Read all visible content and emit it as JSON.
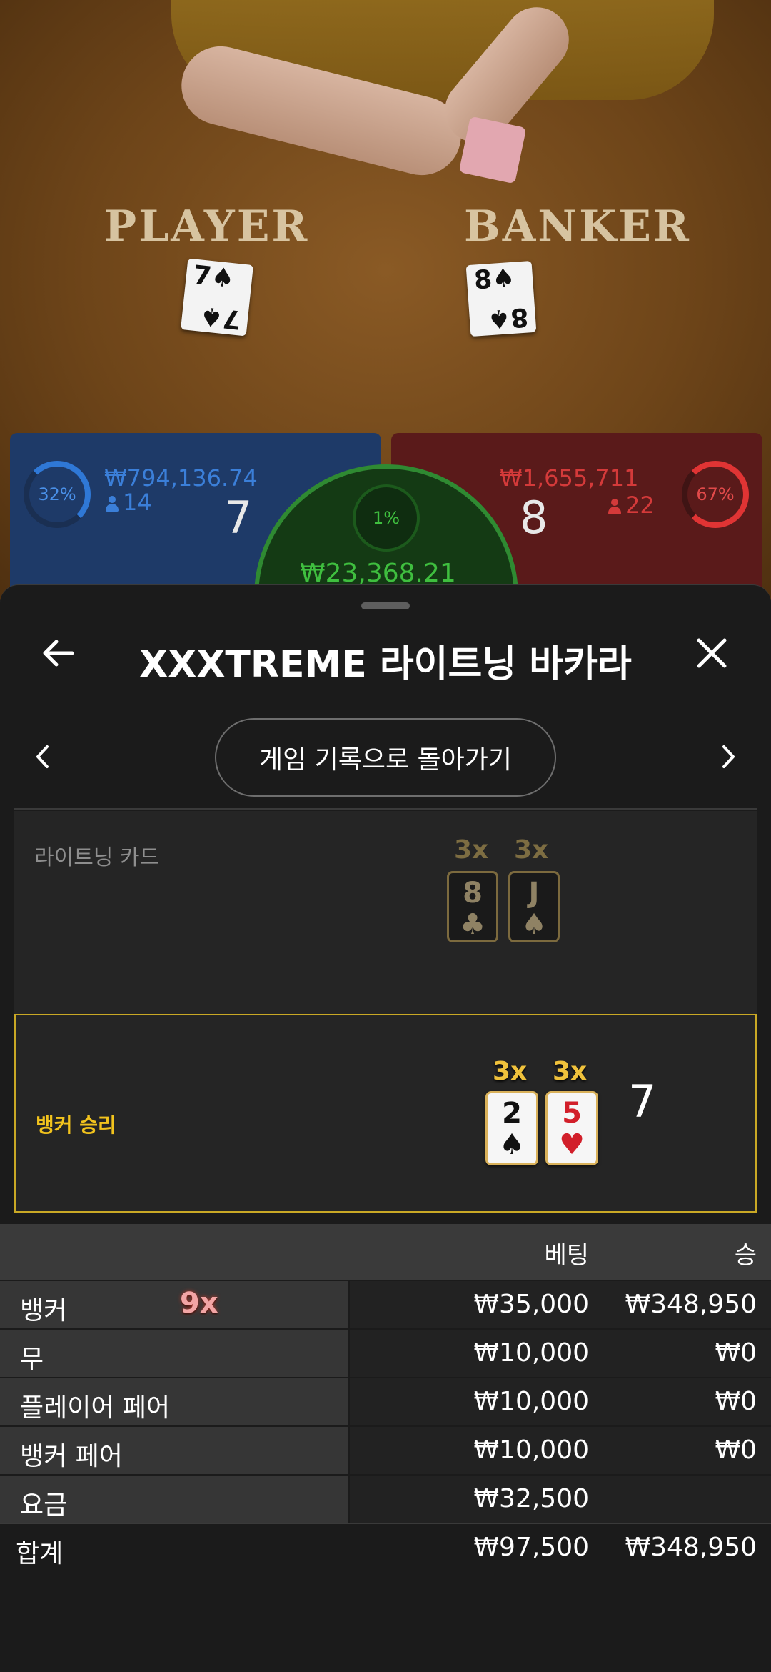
{
  "video": {
    "player_word": "PLAYER",
    "banker_word": "BANKER",
    "player_card": {
      "rank": "7",
      "suit": "♠"
    },
    "banker_card": {
      "rank": "8",
      "suit": "♠"
    }
  },
  "scoreboard": {
    "player": {
      "percent": "32%",
      "amount": "₩794,136.74",
      "people": "14",
      "total": "7",
      "color": "#2f78d6"
    },
    "banker": {
      "percent": "67%",
      "amount": "₩1,655,711",
      "people": "22",
      "total": "8",
      "color": "#e03434"
    },
    "tie": {
      "percent": "1%",
      "amount": "₩23,368.21",
      "color": "#3fbf3f"
    }
  },
  "sheet": {
    "title": "XXXTREME 라이트닝 바카라",
    "history_button": "게임 기록으로 돌아가기",
    "icons": {
      "back": "arrow-left-icon",
      "close": "close-icon",
      "prev": "chevron-left-icon",
      "next": "chevron-right-icon"
    }
  },
  "lightning": {
    "label": "라이트닝 카드",
    "cards": [
      {
        "multiplier": "3x",
        "rank": "8",
        "suit": "♣"
      },
      {
        "multiplier": "3x",
        "rank": "J",
        "suit": "♠"
      }
    ]
  },
  "result": {
    "label": "뱅커 승리",
    "cards": [
      {
        "multiplier": "3x",
        "rank": "2",
        "suit": "♠",
        "red": false
      },
      {
        "multiplier": "3x",
        "rank": "5",
        "suit": "♥",
        "red": true
      }
    ],
    "total": "7",
    "accent": "#c9a825"
  },
  "bets": {
    "headers": {
      "bet": "베팅",
      "win": "승"
    },
    "rows": [
      {
        "name": "뱅커",
        "multiplier": "9x",
        "bet": "₩35,000",
        "win": "₩348,950"
      },
      {
        "name": "무",
        "bet": "₩10,000",
        "win": "₩0"
      },
      {
        "name": "플레이어 페어",
        "bet": "₩10,000",
        "win": "₩0"
      },
      {
        "name": "뱅커 페어",
        "bet": "₩10,000",
        "win": "₩0"
      },
      {
        "name": "요금",
        "bet": "₩32,500",
        "win": ""
      }
    ],
    "total": {
      "name": "합계",
      "bet": "₩97,500",
      "win": "₩348,950"
    }
  }
}
